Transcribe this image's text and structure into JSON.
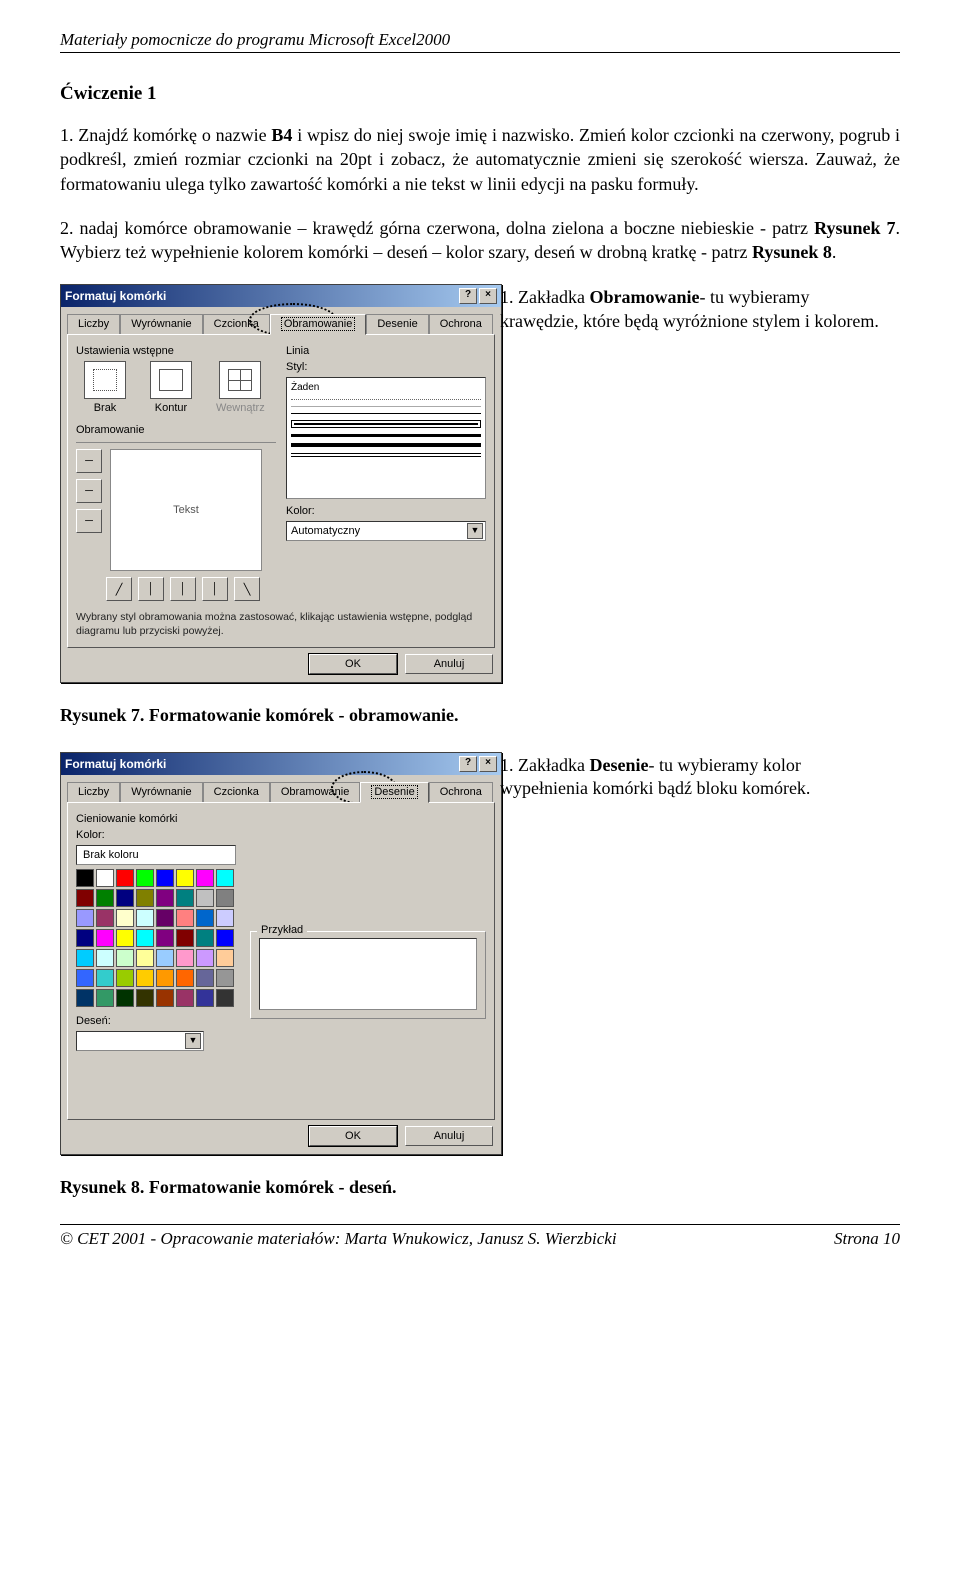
{
  "header": "Materiały pomocnicze do programu Microsoft Excel2000",
  "exercise_title": "Ćwiczenie 1",
  "para1_pre": "1. Znajdź komórkę o nazwie ",
  "para1_bold1": "B4",
  "para1_mid": " i wpisz do niej swoje imię i nazwisko. Zmień kolor czcionki na czerwony, pogrub i podkreśl, zmień rozmiar czcionki na 20pt i zobacz, że automatycznie zmieni się szerokość wiersza. Zauważ, że formatowaniu ulega tylko zawartość komórki a nie tekst w linii edycji na pasku formuły.",
  "para2_pre": "2. nadaj komórce obramowanie – krawędź górna czerwona, dolna zielona a boczne niebieskie - patrz ",
  "para2_bold1": "Rysunek 7",
  "para2_mid": ". Wybierz też wypełnienie kolorem komórki – deseń – kolor szary, deseń w drobną kratkę - patrz ",
  "para2_bold2": "Rysunek 8",
  "para2_end": ".",
  "note1_pre": "1. Zakładka ",
  "note1_bold": "Obramowanie",
  "note1_post": "- tu wybieramy krawędzie, które będą wyróżnione stylem i kolorem.",
  "caption1": "Rysunek 7. Formatowanie komórek - obramowanie.",
  "note2_pre": "1. Zakładka ",
  "note2_bold": "Desenie",
  "note2_post": "- tu wybieramy kolor wypełnienia komórki bądź bloku komórek.",
  "caption2": "Rysunek 8. Formatowanie komórek - deseń.",
  "footer_left": "© CET 2001 - Opracowanie materiałów: Marta Wnukowicz, Janusz S. Wierzbicki",
  "footer_right": "Strona 10",
  "dialog": {
    "title": "Formatuj komórki",
    "tabs": [
      "Liczby",
      "Wyrównanie",
      "Czcionka",
      "Obramowanie",
      "Desenie",
      "Ochrona"
    ],
    "presets_label": "Ustawienia wstępne",
    "presets": [
      "Brak",
      "Kontur",
      "Wewnątrz"
    ],
    "border_label": "Obramowanie",
    "preview_text": "Tekst",
    "line_label": "Linia",
    "style_label": "Styl:",
    "none_style": "Żaden",
    "color_label": "Kolor:",
    "color_value": "Automatyczny",
    "hint": "Wybrany styl obramowania można zastosować, klikając ustawienia wstępne, podgląd diagramu lub przyciski powyżej.",
    "ok": "OK",
    "cancel": "Anuluj"
  },
  "dialog2": {
    "shading_label": "Cieniowanie komórki",
    "color_label": "Kolor:",
    "no_color": "Brak koloru",
    "pattern_label": "Deseń:",
    "sample_label": "Przykład",
    "colors_row1": [
      "#000000",
      "#ffffff",
      "#ff0000",
      "#00ff00",
      "#0000ff",
      "#ffff00",
      "#ff00ff",
      "#00ffff"
    ],
    "colors_row2": [
      "#800000",
      "#008000",
      "#000080",
      "#808000",
      "#800080",
      "#008080",
      "#c0c0c0",
      "#808080"
    ],
    "colors_row3": [
      "#9999ff",
      "#993366",
      "#ffffcc",
      "#ccffff",
      "#660066",
      "#ff8080",
      "#0066cc",
      "#ccccff"
    ],
    "colors_row4": [
      "#000080",
      "#ff00ff",
      "#ffff00",
      "#00ffff",
      "#800080",
      "#800000",
      "#008080",
      "#0000ff"
    ],
    "colors_row5": [
      "#00ccff",
      "#ccffff",
      "#ccffcc",
      "#ffff99",
      "#99ccff",
      "#ff99cc",
      "#cc99ff",
      "#ffcc99"
    ],
    "colors_row6": [
      "#3366ff",
      "#33cccc",
      "#99cc00",
      "#ffcc00",
      "#ff9900",
      "#ff6600",
      "#666699",
      "#969696"
    ],
    "colors_row7": [
      "#003366",
      "#339966",
      "#003300",
      "#333300",
      "#993300",
      "#993366",
      "#333399",
      "#333333"
    ]
  }
}
